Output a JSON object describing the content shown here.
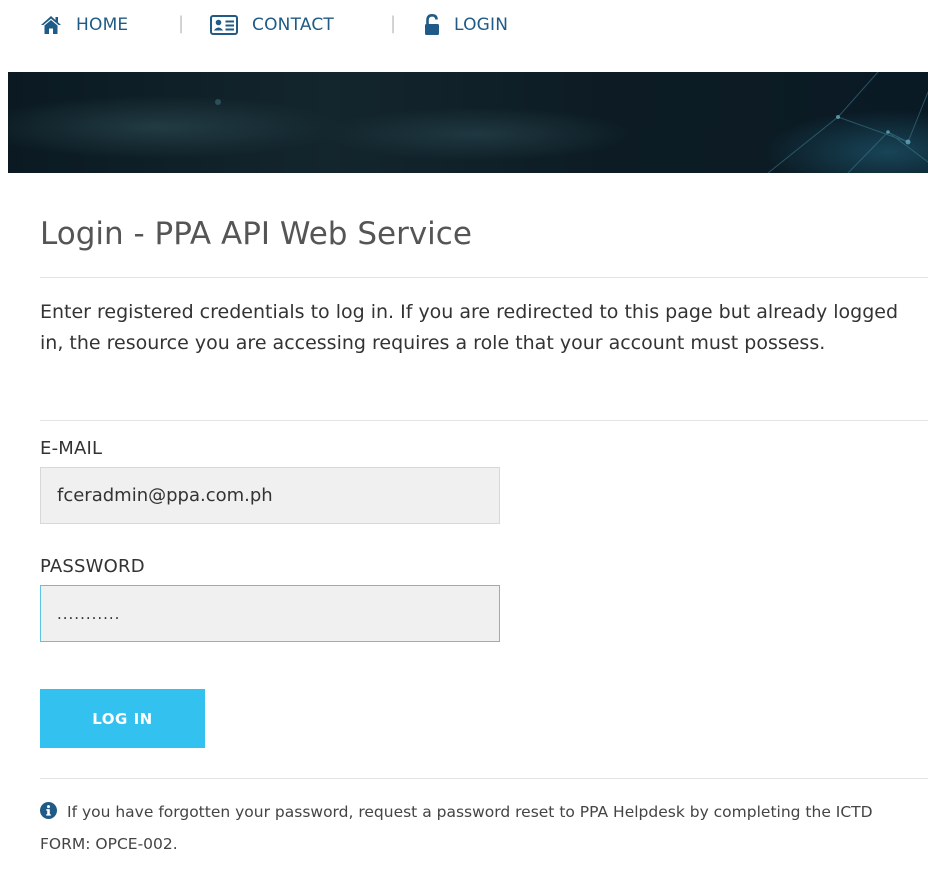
{
  "nav": {
    "items": [
      {
        "label": "HOME",
        "icon": "home-icon"
      },
      {
        "label": "CONTACT",
        "icon": "contact-card-icon"
      },
      {
        "label": "LOGIN",
        "icon": "unlock-icon"
      }
    ],
    "separator": "|",
    "color": "#1f5b86"
  },
  "page": {
    "title": "Login - PPA API Web Service",
    "intro": "Enter registered credentials to log in. If you are redirected to this page but already logged in, the resource you are accessing requires a role that your account must possess."
  },
  "form": {
    "email_label": "E-MAIL",
    "email_value": "fceradmin@ppa.com.ph",
    "password_label": "PASSWORD",
    "password_value": "...........",
    "submit_label": "LOG IN",
    "submit_color": "#33c1ef",
    "focus_border_color": "#5bc4e3"
  },
  "footer": {
    "info_icon": "info-circle-icon",
    "note": "If you have forgotten your password, request a password reset to PPA Helpdesk by completing the ICTD FORM: OPCE-002."
  }
}
